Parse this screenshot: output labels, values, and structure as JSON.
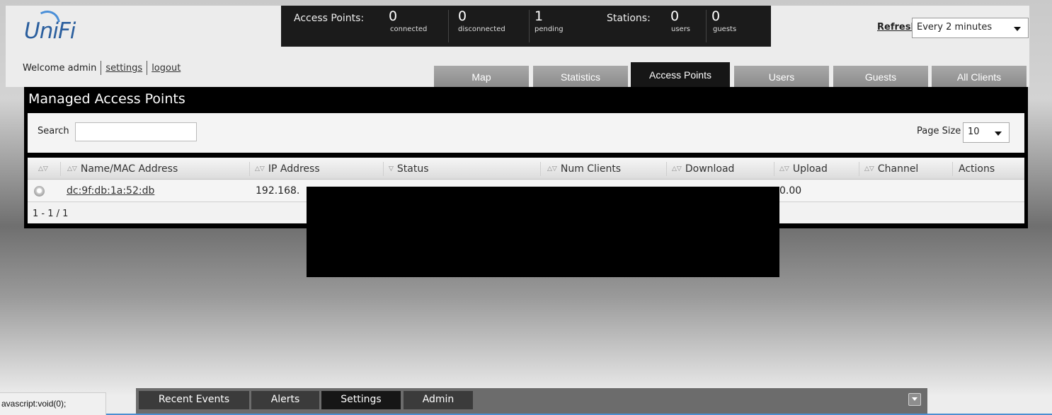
{
  "app": {
    "logo": "UniFi"
  },
  "user": {
    "welcome": "Welcome admin",
    "settings_link": "settings",
    "logout_link": "logout"
  },
  "stats": {
    "access_points_label": "Access Points:",
    "connected": {
      "value": "0",
      "caption": "connected"
    },
    "disconnected": {
      "value": "0",
      "caption": "disconnected"
    },
    "pending": {
      "value": "1",
      "caption": "pending"
    },
    "stations_label": "Stations:",
    "users": {
      "value": "0",
      "caption": "users"
    },
    "guests": {
      "value": "0",
      "caption": "guests"
    }
  },
  "refresh": {
    "link": "Refresh",
    "selected": "Every 2 minutes"
  },
  "tabs": [
    {
      "label": "Map",
      "active": false
    },
    {
      "label": "Statistics",
      "active": false
    },
    {
      "label": "Access Points",
      "active": true
    },
    {
      "label": "Users",
      "active": false
    },
    {
      "label": "Guests",
      "active": false
    },
    {
      "label": "All Clients",
      "active": false
    }
  ],
  "panel": {
    "title": "Managed Access Points",
    "search_label": "Search",
    "search_value": "",
    "page_size_label": "Page Size",
    "page_size_selected": "10"
  },
  "table": {
    "columns": [
      "Name/MAC Address",
      "IP Address",
      "Status",
      "Num Clients",
      "Download",
      "Upload",
      "Channel",
      "Actions"
    ],
    "rows": [
      {
        "name": "dc:9f:db:1a:52:db",
        "ip": "192.168.",
        "upload": "0.00"
      }
    ],
    "pager": "1 - 1 / 1"
  },
  "bottom": {
    "status_url": "avascript:void(0);",
    "tabs": [
      {
        "label": "Recent Events",
        "active": false
      },
      {
        "label": "Alerts",
        "active": false
      },
      {
        "label": "Settings",
        "active": true
      },
      {
        "label": "Admin",
        "active": false
      }
    ]
  },
  "colors": {
    "brand_blue": "#2b5f9e",
    "active_tab": "#161616",
    "inactive_tab": "#9a9a9a"
  }
}
